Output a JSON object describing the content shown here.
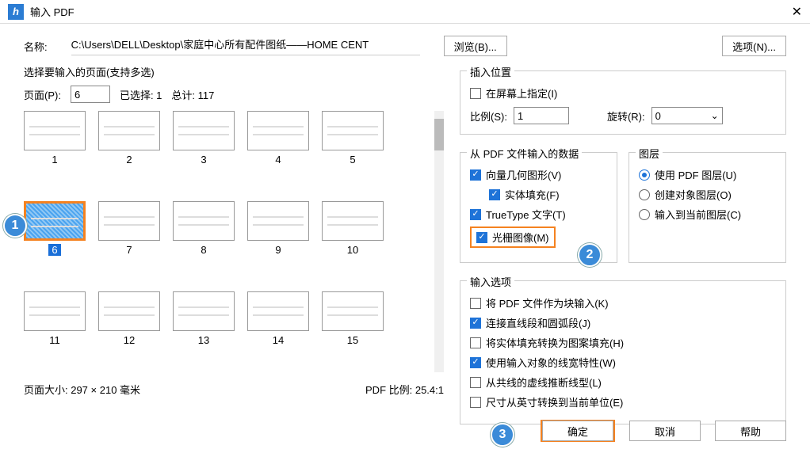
{
  "titlebar": {
    "title": "输入 PDF"
  },
  "name_row": {
    "label": "名称:",
    "path": "C:\\Users\\DELL\\Desktop\\家庭中心所有配件图纸――HOME CENT",
    "browse": "浏览(B)...",
    "options": "选项(N)..."
  },
  "select_label": "选择要输入的页面(支持多选)",
  "page_controls": {
    "page_label": "页面(P):",
    "page_value": "6",
    "selected": "已选择: 1",
    "total": "总计: 117"
  },
  "thumbs": [
    "1",
    "2",
    "3",
    "4",
    "5",
    "6",
    "7",
    "8",
    "9",
    "10",
    "11",
    "12",
    "13",
    "14",
    "15"
  ],
  "selected_thumb": "6",
  "foot_left": "页面大小: 297 × 210 毫米",
  "foot_right": "PDF 比例: 25.4:1",
  "insert": {
    "legend": "插入位置",
    "onscreen": "在屏幕上指定(I)",
    "scale_label": "比例(S):",
    "scale_value": "1",
    "rot_label": "旋转(R):",
    "rot_value": "0"
  },
  "pdfdata": {
    "legend": "从 PDF 文件输入的数据",
    "vector": "向量几何图形(V)",
    "solid": "实体填充(F)",
    "truetype": "TrueType 文字(T)",
    "raster": "光栅图像(M)"
  },
  "layers": {
    "legend": "图层",
    "usepdf": "使用 PDF 图层(U)",
    "createobj": "创建对象图层(O)",
    "tocurrent": "输入到当前图层(C)"
  },
  "inputopt": {
    "legend": "输入选项",
    "asblock": "将 PDF 文件作为块输入(K)",
    "joinarcs": "连接直线段和圆弧段(J)",
    "solidtohatch": "将实体填充转换为图案填充(H)",
    "uselw": "使用输入对象的线宽特性(W)",
    "inferlt": "从共线的虚线推断线型(L)",
    "convunits": "尺寸从英寸转换到当前单位(E)"
  },
  "footer": {
    "ok": "确定",
    "cancel": "取消",
    "help": "帮助"
  }
}
